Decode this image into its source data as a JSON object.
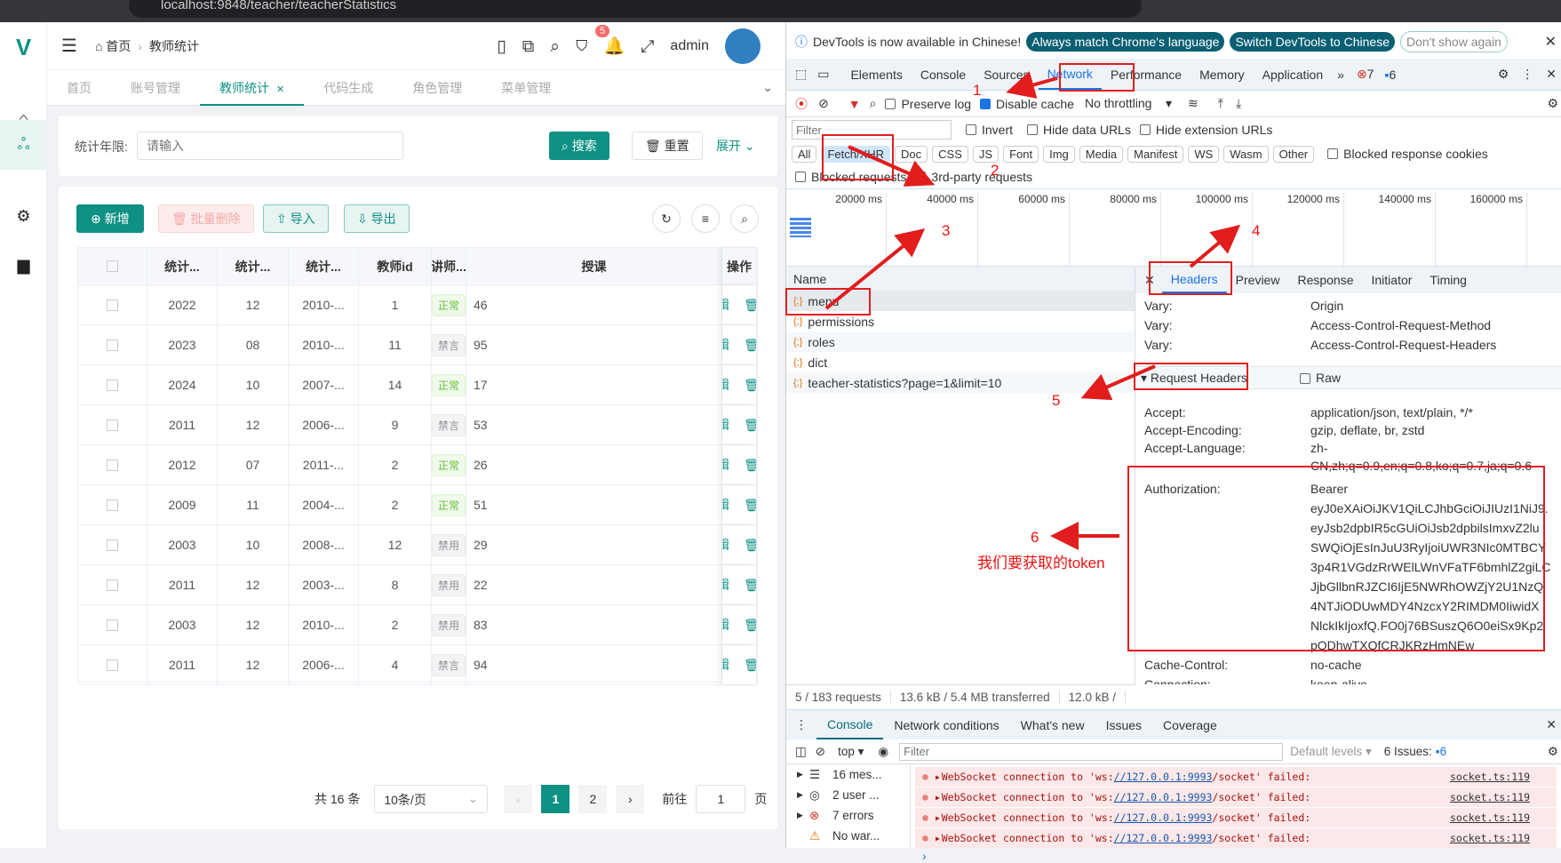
{
  "browser": {
    "url": "localhost:9848/teacher/teacherStatistics"
  },
  "header": {
    "breadcrumb": [
      "首页",
      "教师统计"
    ],
    "user": "admin",
    "notification_count": "5"
  },
  "tabs": [
    {
      "label": "首页"
    },
    {
      "label": "账号管理"
    },
    {
      "label": "教师统计",
      "active": true
    },
    {
      "label": "代码生成"
    },
    {
      "label": "角色管理"
    },
    {
      "label": "菜单管理"
    }
  ],
  "search": {
    "label": "统计年限:",
    "placeholder": "请输入",
    "search": "搜索",
    "reset": "重置",
    "expand": "展开"
  },
  "toolbar": {
    "add": "新增",
    "batch_delete": "批量删除",
    "import": "导入",
    "export": "导出"
  },
  "table": {
    "columns": [
      "统计...",
      "统计...",
      "统计...",
      "教师id",
      "讲师...",
      "授课",
      "操作"
    ],
    "rows": [
      [
        "2022",
        "12",
        "2010-...",
        "1",
        "正常",
        "46"
      ],
      [
        "2023",
        "08",
        "2010-...",
        "11",
        "禁言",
        "95"
      ],
      [
        "2024",
        "10",
        "2007-...",
        "14",
        "正常",
        "17"
      ],
      [
        "2011",
        "12",
        "2006-...",
        "9",
        "禁言",
        "53"
      ],
      [
        "2012",
        "07",
        "2011-...",
        "2",
        "正常",
        "26"
      ],
      [
        "2009",
        "11",
        "2004-...",
        "2",
        "正常",
        "51"
      ],
      [
        "2003",
        "10",
        "2008-...",
        "12",
        "禁用",
        "29"
      ],
      [
        "2011",
        "12",
        "2003-...",
        "8",
        "禁用",
        "22"
      ],
      [
        "2003",
        "12",
        "2010-...",
        "2",
        "禁用",
        "83"
      ],
      [
        "2011",
        "12",
        "2006-...",
        "4",
        "禁言",
        "94"
      ]
    ],
    "edit": "编辑",
    "delete": "删除"
  },
  "pagination": {
    "total": "共 16 条",
    "page_size": "10条/页",
    "pages": [
      "1",
      "2"
    ],
    "current": "1",
    "goto_label": "前往",
    "goto_value": "1",
    "page_suffix": "页"
  },
  "devtools": {
    "infobar": {
      "text": "DevTools is now available in Chinese!",
      "btn1": "Always match Chrome's language",
      "btn2": "Switch DevTools to Chinese",
      "btn3": "Don't show again"
    },
    "tabs": [
      "Elements",
      "Console",
      "Sources",
      "Network",
      "Performance",
      "Memory",
      "Application"
    ],
    "errors": "7",
    "issues": "6",
    "net_toolbar": {
      "preserve": "Preserve log",
      "disable_cache": "Disable cache",
      "throttling": "No throttling"
    },
    "filter": {
      "placeholder": "Filter",
      "invert": "Invert",
      "hide_data": "Hide data URLs",
      "hide_ext": "Hide extension URLs"
    },
    "types": [
      "All",
      "Fetch/XHR",
      "Doc",
      "CSS",
      "JS",
      "Font",
      "Img",
      "Media",
      "Manifest",
      "WS",
      "Wasm",
      "Other"
    ],
    "blocked_cookies": "Blocked response cookies",
    "blocked_requests": "Blocked requests",
    "third_party": "3rd-party requests",
    "timeline": [
      "20000 ms",
      "40000 ms",
      "60000 ms",
      "80000 ms",
      "100000 ms",
      "120000 ms",
      "140000 ms",
      "160000 ms"
    ],
    "name_header": "Name",
    "requests": [
      "menu",
      "permissions",
      "roles",
      "dict",
      "teacher-statistics?page=1&limit=10"
    ],
    "detail_tabs": [
      "Headers",
      "Preview",
      "Response",
      "Initiator",
      "Timing"
    ],
    "response_headers": [
      [
        "Vary:",
        "Origin"
      ],
      [
        "Vary:",
        "Access-Control-Request-Method"
      ],
      [
        "Vary:",
        "Access-Control-Request-Headers"
      ]
    ],
    "request_headers_title": "Request Headers",
    "raw": "Raw",
    "request_headers": [
      [
        "Accept:",
        "application/json, text/plain, */*"
      ],
      [
        "Accept-Encoding:",
        "gzip, deflate, br, zstd"
      ],
      [
        "Accept-Language:",
        "zh-"
      ],
      [
        "",
        "CN,zh;q=0.9,en;q=0.8,ko;q=0.7,ja;q=0.6"
      ]
    ],
    "authorization": {
      "key": "Authorization:",
      "lines": [
        "Bearer",
        "eyJ0eXAiOiJKV1QiLCJhbGciOiJIUzI1NiJ9.",
        "eyJsb2dpbIR5cGUiOiJsb2dpbilsImxvZ2lu",
        "SWQiOjEsInJuU3RyIjoiUWR3NIc0MTBCY",
        "3p4R1VGdzRrWElLWnVFaTF6bmhlZ2giLC",
        "JjbGllbnRJZCI6IjE5NWRhOWZjY2U1NzQ",
        "4NTJiODUwMDY4NzcxY2RIMDM0IiwidX",
        "NlckIkIjoxfQ.FO0j76BSuszQ6O0eiSx9Kp2",
        "pQDhwTXQfCRJKRzHmNEw"
      ]
    },
    "more_headers": [
      [
        "Cache-Control:",
        "no-cache"
      ],
      [
        "Connection:",
        "keep-alive"
      ]
    ],
    "status": [
      "5 / 183 requests",
      "13.6 kB / 5.4 MB transferred",
      "12.0 kB /"
    ],
    "drawer_tabs": [
      "Console",
      "Network conditions",
      "What's new",
      "Issues",
      "Coverage"
    ],
    "console": {
      "context": "top",
      "filter_placeholder": "Filter",
      "levels": "Default levels",
      "issues": "6 Issues:",
      "issues_count": "6",
      "sidebar": [
        "16 mes...",
        "2 user ...",
        "7 errors",
        "No war..."
      ],
      "message_prefix": "WebSocket connection to 'ws:",
      "message_link": "//127.0.0.1:9993",
      "message_suffix": "/socket' failed:",
      "source": "socket.ts:119"
    }
  },
  "annotations": {
    "n1": "1",
    "n2": "2",
    "n3": "3",
    "n4": "4",
    "n5": "5",
    "n6": "6",
    "token_note": "我们要获取的token"
  },
  "colors": {
    "brand": "#0e9183",
    "annotation": "#e11d1d"
  }
}
